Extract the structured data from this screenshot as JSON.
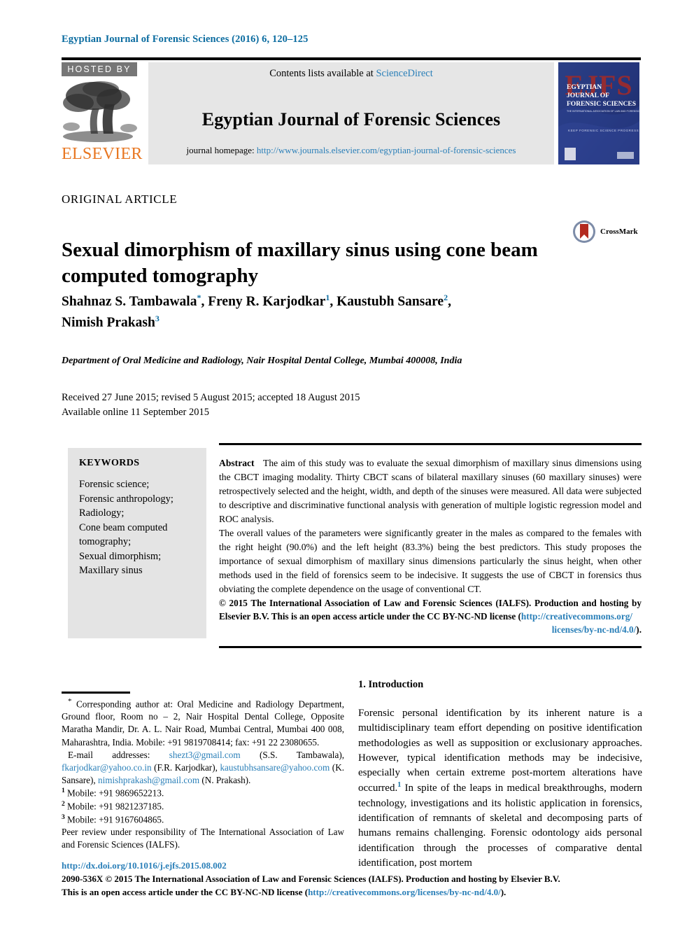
{
  "running_head": "Egyptian Journal of Forensic Sciences (2016) 6, 120–125",
  "masthead": {
    "hosted_by": "HOSTED BY",
    "publisher": "ELSEVIER",
    "contents_prefix": "Contents lists available at",
    "contents_link": "ScienceDirect",
    "journal_name": "Egyptian Journal of Forensic Sciences",
    "homepage_prefix": "journal homepage:",
    "homepage_url": "http://www.journals.elsevier.com/egyptian-journal-of-forensic-sciences",
    "cover": {
      "acronym": "EJFS",
      "line1": "EGYPTIAN",
      "line2": "JOURNAL OF",
      "line3": "FORENSIC SCIENCES",
      "line4": "THE INTERNATIONAL ASSOCIATION OF LAW AND FORENSIC SCIENCES",
      "line5": "KEEP FORENSIC SCIENCE PROGRESS TOWARDS"
    }
  },
  "article": {
    "kicker": "ORIGINAL ARTICLE",
    "title": "Sexual dimorphism of maxillary sinus using cone beam computed tomography",
    "crossmark_label": "CrossMark",
    "authors_line1_a": "Shahnaz S. Tambawala",
    "authors_line1_b": ", Freny R. Karjodkar",
    "authors_line1_c": ", Kaustubh Sansare",
    "authors_line2": "Nimish Prakash",
    "affiliation": "Department of Oral Medicine and Radiology, Nair Hospital Dental College, Mumbai 400008, India",
    "received_line": "Received 27 June 2015; revised 5 August 2015; accepted 18 August 2015",
    "available_line": "Available online 11 September 2015"
  },
  "keywords": {
    "heading": "KEYWORDS",
    "items": [
      "Forensic science;",
      "Forensic anthropology;",
      "Radiology;",
      "Cone beam computed",
      "tomography;",
      "Sexual dimorphism;",
      "Maxillary sinus"
    ]
  },
  "abstract": {
    "label": "Abstract",
    "paragraph1": "The aim of this study was to evaluate the sexual dimorphism of maxillary sinus dimensions using the CBCT imaging modality. Thirty CBCT scans of bilateral maxillary sinuses (60 maxillary sinuses) were retrospectively selected and the height, width, and depth of the sinuses were measured. All data were subjected to descriptive and discriminative functional analysis with generation of multiple logistic regression model and ROC analysis.",
    "paragraph2": "The overall values of the parameters were significantly greater in the males as compared to the females with the right height (90.0%) and the left height (83.3%) being the best predictors. This study proposes the importance of sexual dimorphism of maxillary sinus dimensions particularly the sinus height, when other methods used in the field of forensics seem to be indecisive. It suggests the use of CBCT in forensics thus obviating the complete dependence on the usage of conventional CT.",
    "copyright_text": "© 2015 The International Association of Law and Forensic Sciences (IALFS). Production and hosting by Elsevier B.V. This is an open access article under the CC BY-NC-ND license (",
    "license_url_head": "http://creativecommons.org/",
    "license_url_tail": "licenses/by-nc-nd/4.0/",
    "copyright_close": ")."
  },
  "footnotes": {
    "corresponding": "Corresponding author at: Oral Medicine and Radiology Department, Ground floor, Room no – 2, Nair Hospital Dental College, Opposite Maratha Mandir, Dr. A. L. Nair Road, Mumbai Central, Mumbai 400 008, Maharashtra, India. Mobile: +91 9819708414; fax: +91 22 23080655.",
    "email_label": "E-mail addresses:",
    "email1": "shezt3@gmail.com",
    "email1_name": "(S.S. Tambawala),",
    "email2": "fkarjodkar@yahoo.co.in",
    "email2_name": "(F.R. Karjodkar),",
    "email3": "kaustubhsansare@yahoo.com",
    "email3_name": "(K. Sansare),",
    "email4": "nimishprakash@gmail.com",
    "email4_name": "(N. Prakash).",
    "mobile1": "Mobile: +91 9869652213.",
    "mobile2": "Mobile: +91 9821237185.",
    "mobile3": "Mobile: +91 9167604865.",
    "peer_review": "Peer review under responsibility of The International Association of Law and Forensic Sciences (IALFS)."
  },
  "introduction": {
    "heading": "1. Introduction",
    "text_a": "Forensic personal identification by its inherent nature is a multidisciplinary team effort depending on positive identification methodologies as well as supposition or exclusionary approaches. However, typical identification methods may be indecisive, especially when certain extreme post-mortem alterations have occurred.",
    "ref_marker": "1",
    "text_b": "In spite of the leaps in medical breakthroughs, modern technology, investigations and its holistic application in forensics, identification of remnants of skeletal and decomposing parts of humans remains challenging. Forensic odontology aids personal identification through the processes of comparative dental identification, post mortem"
  },
  "page_footer": {
    "doi": "http://dx.doi.org/10.1016/j.ejfs.2015.08.002",
    "line1": "2090-536X © 2015 The International Association of Law and Forensic Sciences (IALFS). Production and hosting by Elsevier B.V.",
    "line2_pre": "This is an open access article under the CC BY-NC-ND license (",
    "line2_link": "http://creativecommons.org/licenses/by-nc-nd/4.0/",
    "line2_post": ")."
  },
  "colors": {
    "link": "#2a7fb8",
    "runninghead": "#0b6ca0",
    "elsevier_orange": "#E87722",
    "hosted_gray": "#767676",
    "keywords_bg": "#e4e4e4",
    "contents_bg": "#e6e6e6"
  }
}
